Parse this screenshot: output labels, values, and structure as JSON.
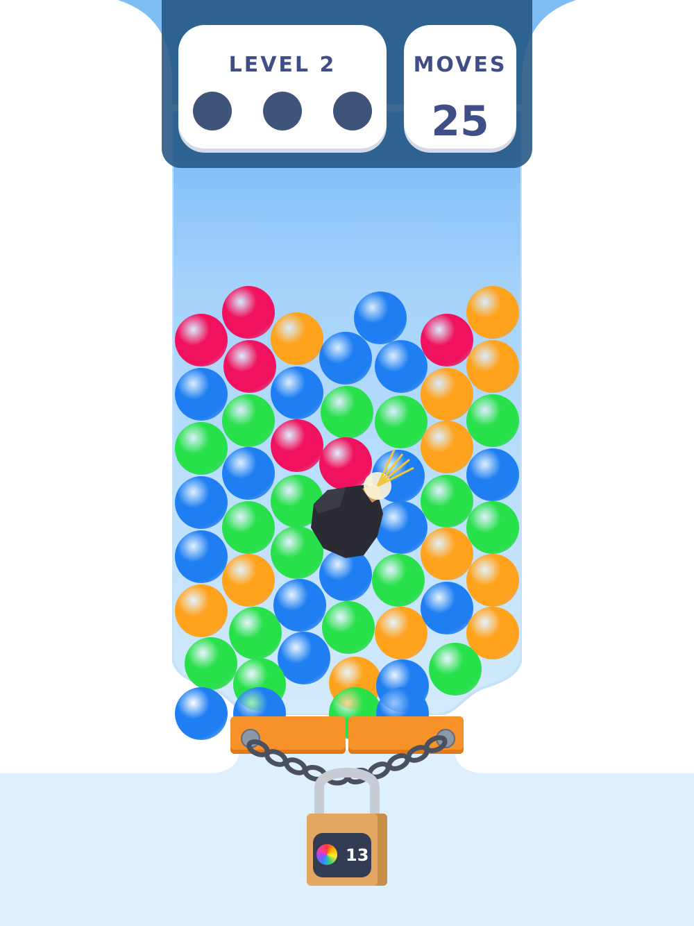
{
  "hud": {
    "level_label": "LEVEL 2",
    "moves_label": "MOVES",
    "moves_value": "25",
    "progress_dots": 3
  },
  "colors": {
    "pink": "#f0125e",
    "orange": "#ffa21c",
    "blue": "#1f7ff2",
    "green": "#27e04a",
    "hud_bg": "#2b5e8c",
    "jar_top": "#7dbdfb",
    "gate": "#f7922b",
    "lock": "#e3a761"
  },
  "balls": [
    {
      "c": "pink"
    },
    {
      "c": "pink"
    },
    {
      "c": "orange"
    },
    {
      "c": "blue"
    },
    {
      "c": "pink"
    },
    {
      "c": "orange"
    },
    {
      "c": "pink"
    },
    {
      "c": "blue"
    },
    {
      "c": "blue"
    },
    {
      "c": "orange"
    },
    {
      "c": "blue"
    },
    {
      "c": "blue"
    },
    {
      "c": "green"
    },
    {
      "c": "green"
    },
    {
      "c": "orange"
    },
    {
      "c": "green"
    },
    {
      "c": "green"
    },
    {
      "c": "green"
    },
    {
      "c": "pink"
    },
    {
      "c": "pink"
    },
    {
      "c": "blue"
    },
    {
      "c": "orange"
    },
    {
      "c": "blue"
    },
    {
      "c": "blue"
    },
    {
      "c": "blue"
    },
    {
      "c": "green"
    },
    {
      "c": "green"
    },
    {
      "c": "blue"
    },
    {
      "c": "green"
    },
    {
      "c": "green"
    },
    {
      "c": "blue"
    },
    {
      "c": "green"
    },
    {
      "c": "green"
    },
    {
      "c": "orange"
    },
    {
      "c": "orange"
    },
    {
      "c": "orange"
    },
    {
      "c": "orange"
    },
    {
      "c": "blue"
    },
    {
      "c": "green"
    },
    {
      "c": "orange"
    },
    {
      "c": "blue"
    },
    {
      "c": "green"
    },
    {
      "c": "blue"
    },
    {
      "c": "green"
    },
    {
      "c": "orange"
    },
    {
      "c": "blue"
    },
    {
      "c": "orange"
    },
    {
      "c": "green"
    },
    {
      "c": "blue"
    },
    {
      "c": "green"
    },
    {
      "c": "blue"
    },
    {
      "c": "blue"
    },
    {
      "c": "green"
    },
    {
      "c": "blue"
    }
  ],
  "lock": {
    "count": "13",
    "icon": "rainbow-ball-icon"
  }
}
